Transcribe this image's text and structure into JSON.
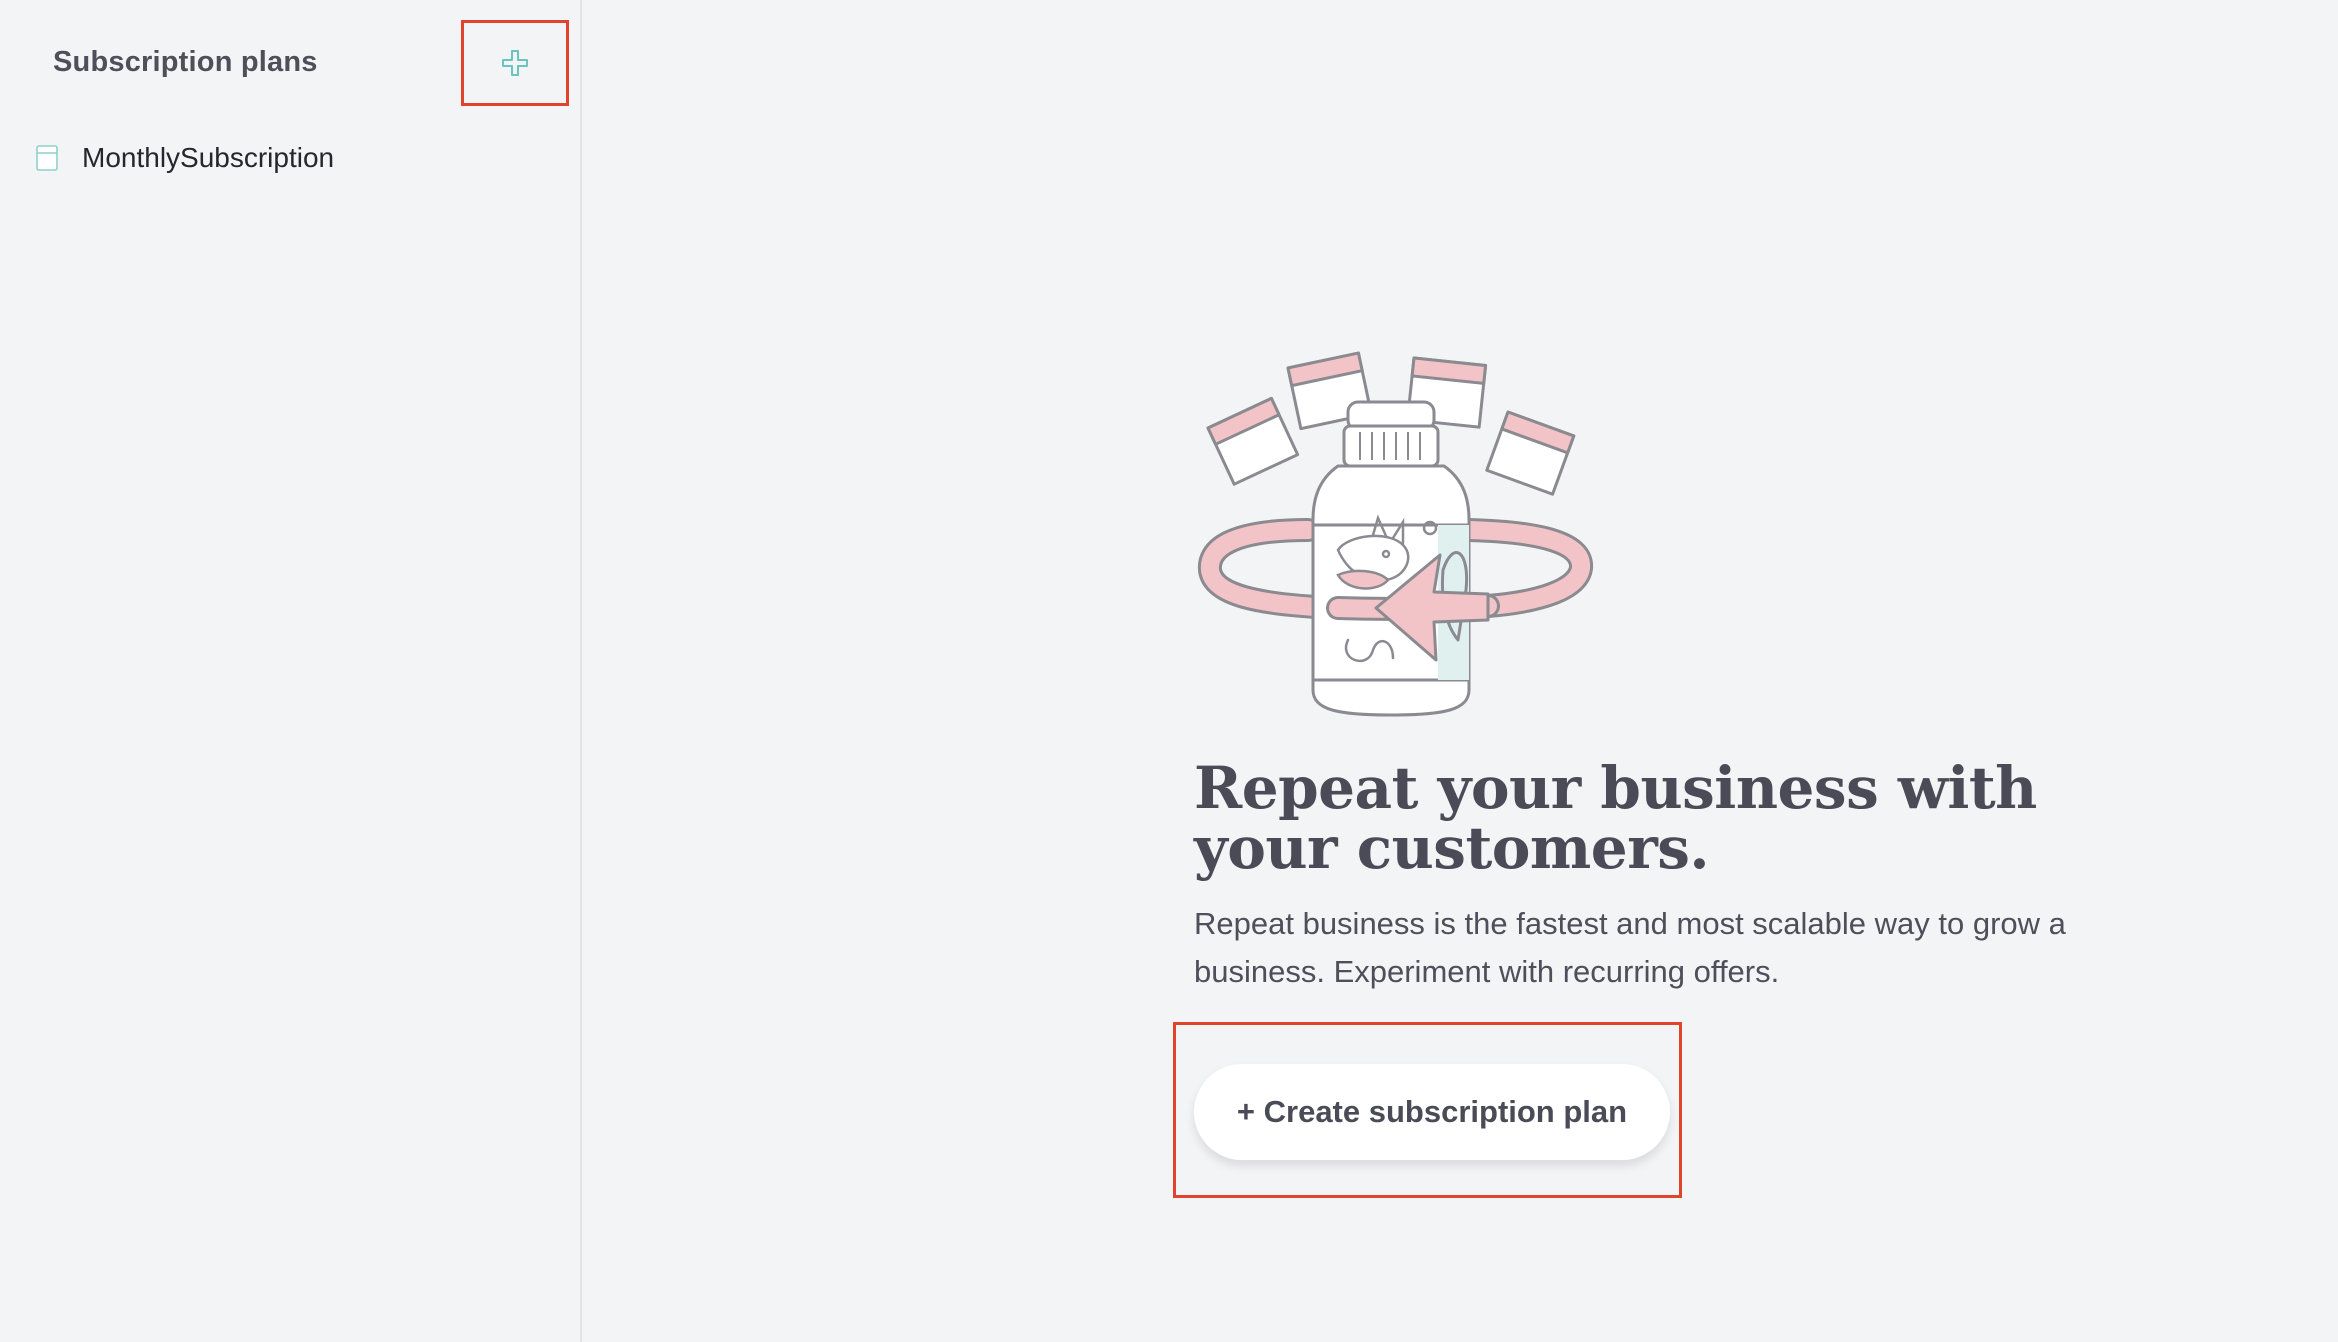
{
  "sidebar": {
    "title": "Subscription plans",
    "add_icon": "plus-icon",
    "items": [
      {
        "label": "MonthlySubscription",
        "icon": "plan-calendar-icon"
      }
    ]
  },
  "main": {
    "illustration": "subscription-bottle-illustration",
    "headline": "Repeat your business with your customers.",
    "description": "Repeat business is the fastest and most scalable way to grow a business. Experiment with recurring offers.",
    "create_button_label": "+ Create subscription plan"
  },
  "colors": {
    "background": "#f3f4f6",
    "highlight_border": "#e0452b",
    "accent_teal": "#6cc4c0",
    "accent_pink": "#f2c4c8",
    "text_dark": "#4a4b57"
  }
}
